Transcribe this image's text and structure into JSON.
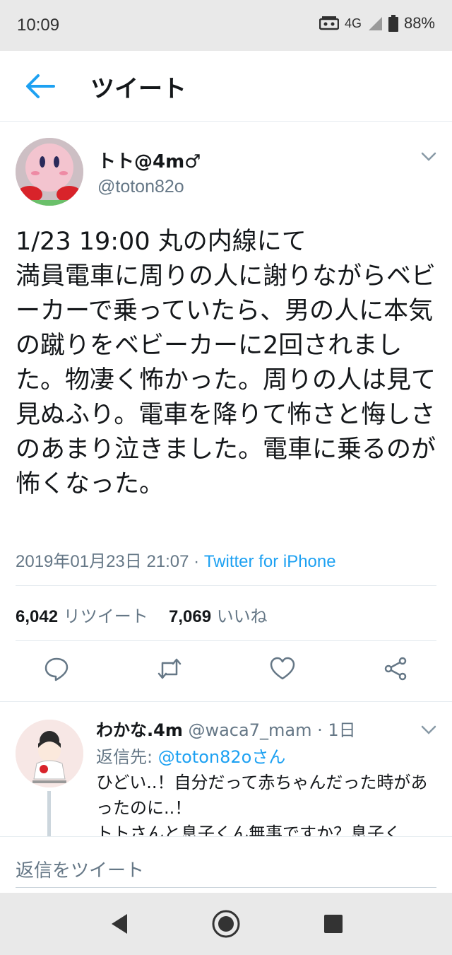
{
  "status_bar": {
    "time": "10:09",
    "network": "4G",
    "battery": "88%"
  },
  "header": {
    "title": "ツイート"
  },
  "tweet": {
    "author_name": "トト@4m♂",
    "author_handle": "@toton82o",
    "text": "1/23 19:00 丸の内線にて\n満員電車に周りの人に謝りながらベビーカーで乗っていたら、男の人に本気の蹴りをベビーカーに2回されました。物凄く怖かった。周りの人は見て見ぬふり。電車を降りて怖さと悔しさのあまり泣きました。電車に乗るのが怖くなった。",
    "timestamp": "2019年01月23日 21:07",
    "separator": " · ",
    "client": "Twitter for iPhone",
    "retweet_count": "6,042",
    "retweet_label": "リツイート",
    "like_count": "7,069",
    "like_label": "いいね"
  },
  "reply": {
    "author_name": "わかな.4m",
    "author_handle": "@waca7_mam",
    "age": "· 1日",
    "reply_to_prefix": "返信先: ",
    "reply_to_mention": "@toton82oさん",
    "text": "ひどい..！自分だって赤ちゃんだった時があったのに..！\nトトさんと息子くん無事ですか？息子く"
  },
  "compose": {
    "placeholder": "返信をツイート"
  },
  "colors": {
    "accent": "#1da1f2",
    "secondary_text": "#657786",
    "primary_text": "#14171a",
    "system_bar": "#e9e9e9"
  },
  "icons": {
    "back": "arrow-left-icon",
    "reply": "comment-icon",
    "retweet": "retweet-icon",
    "like": "heart-icon",
    "share": "share-icon",
    "chevron": "chevron-down-icon",
    "nav_back": "triangle-back-icon",
    "nav_home": "circle-home-icon",
    "nav_recents": "square-recents-icon"
  }
}
